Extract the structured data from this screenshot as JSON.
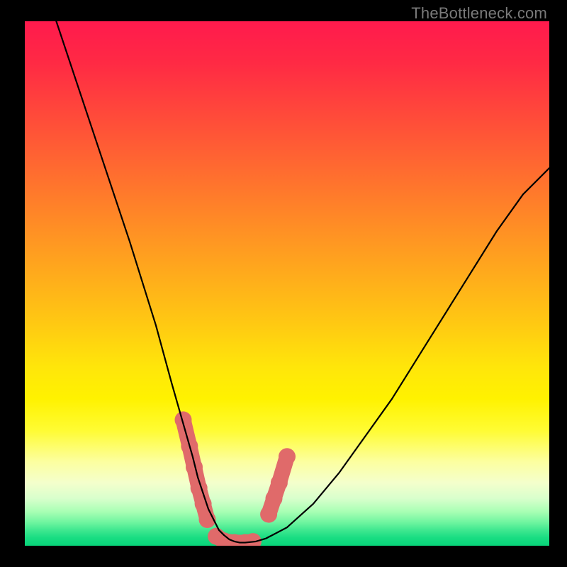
{
  "watermark": "TheBottleneck.com",
  "chart_data": {
    "type": "line",
    "title": "",
    "xlabel": "",
    "ylabel": "",
    "xlim": [
      0,
      100
    ],
    "ylim": [
      0,
      100
    ],
    "grid": false,
    "legend": false,
    "series": [
      {
        "name": "bottleneck-curve",
        "x": [
          6,
          10,
          15,
          20,
          25,
          28,
          30,
          32,
          33,
          34,
          35,
          36,
          37,
          38,
          39,
          40,
          41,
          42,
          44,
          46,
          50,
          55,
          60,
          65,
          70,
          75,
          80,
          85,
          90,
          95,
          100
        ],
        "values": [
          100,
          88,
          73,
          58,
          42,
          31,
          24,
          17,
          13,
          10,
          7,
          5,
          3,
          2,
          1.2,
          0.8,
          0.6,
          0.6,
          0.8,
          1.4,
          3.5,
          8,
          14,
          21,
          28,
          36,
          44,
          52,
          60,
          67,
          72
        ]
      }
    ],
    "markers": [
      {
        "name": "highlight-left-slope",
        "shape": "rounded-segment",
        "color": "#e06a6a",
        "points": [
          {
            "x": 30.2,
            "y": 24
          },
          {
            "x": 31.4,
            "y": 19
          },
          {
            "x": 32.3,
            "y": 15
          },
          {
            "x": 33.2,
            "y": 11
          },
          {
            "x": 34.0,
            "y": 8
          },
          {
            "x": 34.8,
            "y": 5
          }
        ]
      },
      {
        "name": "highlight-valley-floor",
        "shape": "rounded-segment",
        "color": "#e06a6a",
        "points": [
          {
            "x": 36.5,
            "y": 1.8
          },
          {
            "x": 38.0,
            "y": 0.9
          },
          {
            "x": 40.0,
            "y": 0.6
          },
          {
            "x": 42.0,
            "y": 0.6
          },
          {
            "x": 43.5,
            "y": 0.8
          }
        ]
      },
      {
        "name": "highlight-right-slope",
        "shape": "rounded-segment",
        "color": "#e06a6a",
        "points": [
          {
            "x": 46.5,
            "y": 6
          },
          {
            "x": 47.5,
            "y": 9
          },
          {
            "x": 48.5,
            "y": 12
          },
          {
            "x": 50.0,
            "y": 17
          }
        ]
      }
    ]
  }
}
